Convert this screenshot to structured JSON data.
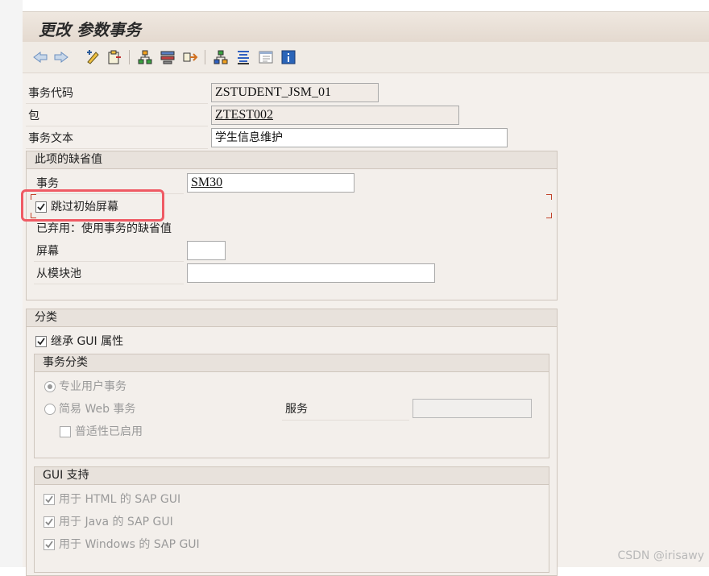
{
  "window": {
    "title": "更改 参数事务"
  },
  "toolbar": {
    "icons": [
      "back-arrow-icon",
      "forward-arrow-icon",
      "display-change-icon",
      "other-object-icon",
      "hierarchy-icon",
      "where-used-icon",
      "transport-icon",
      "structure-icon",
      "inventory-icon",
      "layout-icon",
      "info-icon"
    ]
  },
  "header": {
    "tcode_label": "事务代码",
    "tcode_value": "ZSTUDENT_JSM_01",
    "package_label": "包",
    "package_value": "ZTEST002",
    "text_label": "事务文本",
    "text_value": "学生信息维护"
  },
  "defaults": {
    "title": "此项的缺省值",
    "transaction_label": "事务",
    "transaction_value": "SM30",
    "skip_initial_label": "跳过初始屏幕",
    "obsolete_note": "已弃用：使用事务的缺省值",
    "screen_label": "屏幕",
    "screen_value": "",
    "module_pool_label": "从模块池",
    "module_pool_value": ""
  },
  "classification": {
    "title": "分类",
    "inherit_gui_label": "继承 GUI 属性",
    "tx_class": {
      "title": "事务分类",
      "professional_label": "专业用户事务",
      "easy_web_label": "简易 Web 事务",
      "service_label": "服务",
      "service_value": "",
      "pervasive_label": "普适性已启用"
    },
    "gui_support": {
      "title": "GUI 支持",
      "html_label": "用于 HTML 的 SAP GUI",
      "java_label": "用于 Java 的 SAP GUI",
      "windows_label": "用于 Windows 的 SAP GUI"
    }
  },
  "watermark": "CSDN @irisawy",
  "colors": {
    "highlight": "#ef5a64",
    "title_bg": "#e4d9cf",
    "screen_bg": "#f4f0ec"
  }
}
